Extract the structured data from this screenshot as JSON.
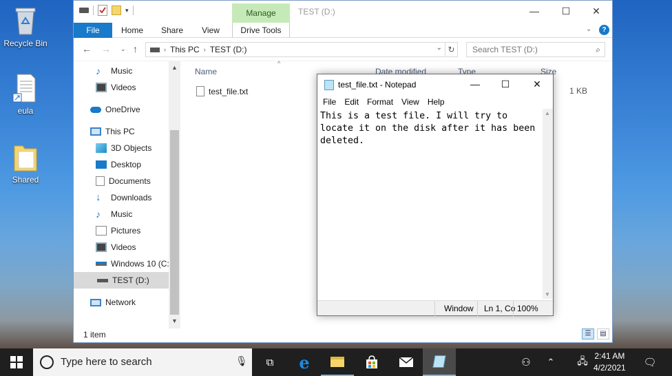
{
  "desktop": {
    "icons": [
      {
        "label": "Recycle Bin"
      },
      {
        "label": "eula"
      },
      {
        "label": "Shared"
      }
    ]
  },
  "explorer": {
    "manage_tab": "Manage",
    "title": "TEST (D:)",
    "ribbon_tabs": [
      "File",
      "Home",
      "Share",
      "View",
      "Drive Tools"
    ],
    "address": {
      "crumb1": "This PC",
      "crumb2": "TEST (D:)"
    },
    "search_placeholder": "Search TEST (D:)",
    "nav": [
      {
        "label": "Music"
      },
      {
        "label": "Videos"
      },
      {
        "label": "OneDrive"
      },
      {
        "label": "This PC"
      },
      {
        "label": "3D Objects"
      },
      {
        "label": "Desktop"
      },
      {
        "label": "Documents"
      },
      {
        "label": "Downloads"
      },
      {
        "label": "Music"
      },
      {
        "label": "Pictures"
      },
      {
        "label": "Videos"
      },
      {
        "label": "Windows 10 (C:)"
      },
      {
        "label": "TEST (D:)"
      },
      {
        "label": "Network"
      }
    ],
    "columns": {
      "name": "Name",
      "date": "Date modified",
      "type": "Type",
      "size": "Size"
    },
    "files": [
      {
        "name": "test_file.txt",
        "size": "1 KB"
      }
    ],
    "status": "1 item"
  },
  "notepad": {
    "title": "test_file.txt - Notepad",
    "menu": [
      "File",
      "Edit",
      "Format",
      "View",
      "Help"
    ],
    "content": "This is a test file. I will try to\nlocate it on the disk after it has been\ndeleted.",
    "status": {
      "eol": "Window",
      "position": "Ln 1, Co",
      "zoom": "100%"
    }
  },
  "taskbar": {
    "search_placeholder": "Type here to search",
    "time": "2:41 AM",
    "date": "4/2/2021"
  }
}
